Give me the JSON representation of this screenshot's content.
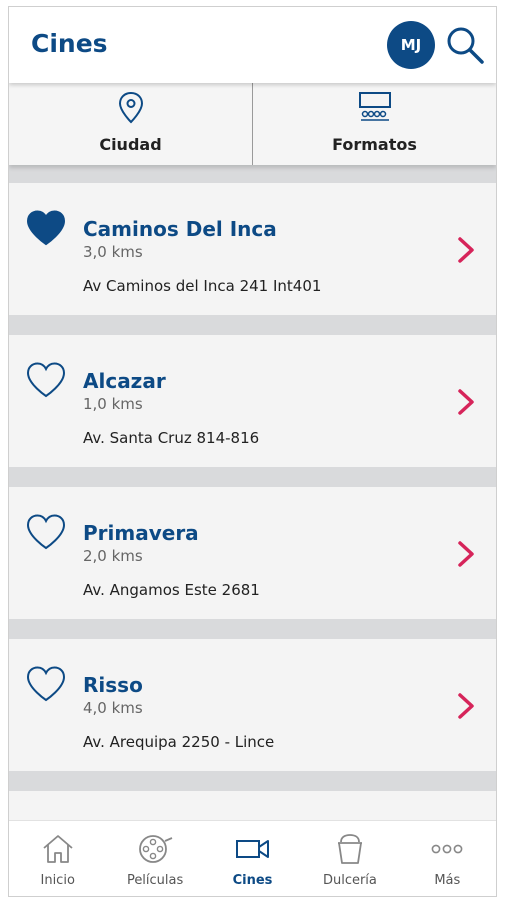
{
  "header": {
    "title": "Cines",
    "avatar_initials": "MJ"
  },
  "filters": [
    {
      "label": "Ciudad",
      "icon": "location-pin-icon"
    },
    {
      "label": "Formatos",
      "icon": "theater-screen-icon"
    }
  ],
  "cinemas": [
    {
      "name": "Caminos Del Inca",
      "distance": "3,0 kms",
      "address": "Av Caminos del Inca 241 Int401",
      "favorite": true
    },
    {
      "name": "Alcazar",
      "distance": "1,0 kms",
      "address": "Av. Santa Cruz 814-816",
      "favorite": false
    },
    {
      "name": "Primavera",
      "distance": "2,0 kms",
      "address": "Av. Angamos Este 2681",
      "favorite": false
    },
    {
      "name": "Risso",
      "distance": "4,0 kms",
      "address": "Av. Arequipa 2250 - Lince",
      "favorite": false
    }
  ],
  "nav": [
    {
      "label": "Inicio",
      "icon": "home-icon",
      "active": false
    },
    {
      "label": "Películas",
      "icon": "film-reel-icon",
      "active": false
    },
    {
      "label": "Cines",
      "icon": "video-camera-icon",
      "active": true
    },
    {
      "label": "Dulcería",
      "icon": "popcorn-bucket-icon",
      "active": false
    },
    {
      "label": "Más",
      "icon": "more-dots-icon",
      "active": false
    }
  ],
  "colors": {
    "brand": "#0d4a85",
    "accent": "#d6245a",
    "background": "#d9dadc"
  }
}
